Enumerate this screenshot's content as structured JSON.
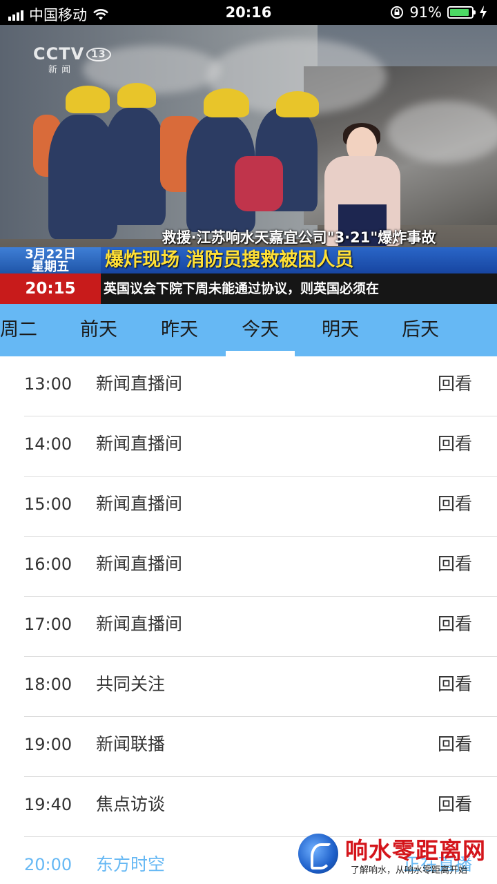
{
  "status_bar": {
    "carrier": "中国移动",
    "time": "20:16",
    "battery_text": "91%",
    "battery_level": 0.91,
    "battery_color": "#4cd964"
  },
  "video": {
    "channel_logo": "CCTV",
    "channel_number": "13",
    "channel_sub": "新 闻",
    "caption_top": "救援·江苏响水天嘉宜公司\"3·21\"爆炸事故",
    "date_line1": "3月22日",
    "date_line2": "星期五",
    "headline": "爆炸现场 消防员搜救被困人员",
    "clock": "20:15",
    "ticker": "英国议会下院下周未能通过协议，则英国必须在"
  },
  "day_tabs": {
    "items": [
      "周二",
      "前天",
      "昨天",
      "今天",
      "明天",
      "后天"
    ],
    "selected": "今天",
    "background": "#66b8f4"
  },
  "schedule": [
    {
      "time": "13:00",
      "title": "新闻直播间",
      "action": "回看"
    },
    {
      "time": "14:00",
      "title": "新闻直播间",
      "action": "回看"
    },
    {
      "time": "15:00",
      "title": "新闻直播间",
      "action": "回看"
    },
    {
      "time": "16:00",
      "title": "新闻直播间",
      "action": "回看"
    },
    {
      "time": "17:00",
      "title": "新闻直播间",
      "action": "回看"
    },
    {
      "time": "18:00",
      "title": "共同关注",
      "action": "回看"
    },
    {
      "time": "19:00",
      "title": "新闻联播",
      "action": "回看"
    },
    {
      "time": "19:40",
      "title": "焦点访谈",
      "action": "回看"
    },
    {
      "time": "20:00",
      "title": "东方时空",
      "action": "正在直播",
      "current": true
    }
  ],
  "watermark": {
    "title": "响水零距离网",
    "subtitle": "了解响水，从响水零距离开始"
  }
}
